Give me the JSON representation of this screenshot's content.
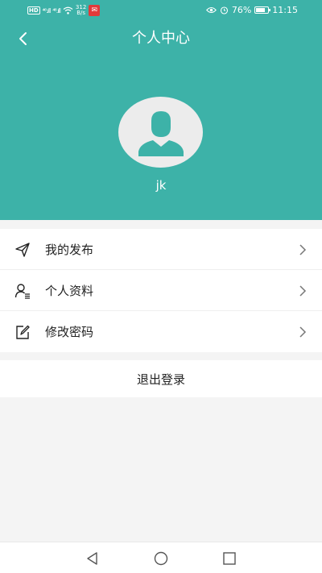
{
  "status_bar": {
    "network_badge": "HD",
    "signal_1": "⁴⁶.ıll",
    "signal_2": "⁴⁶.ıll",
    "speed_value": "312",
    "speed_unit": "B/s",
    "battery_percent": "76%",
    "time": "11:15"
  },
  "header": {
    "title": "个人中心",
    "username": "jk"
  },
  "menu": {
    "items": [
      {
        "label": "我的发布",
        "icon": "send-icon"
      },
      {
        "label": "个人资料",
        "icon": "profile-icon"
      },
      {
        "label": "修改密码",
        "icon": "edit-icon"
      }
    ]
  },
  "logout_label": "退出登录",
  "colors": {
    "header_bg": "#3db2a8",
    "page_bg": "#f4f4f4",
    "avatar_bg": "#ececec"
  }
}
